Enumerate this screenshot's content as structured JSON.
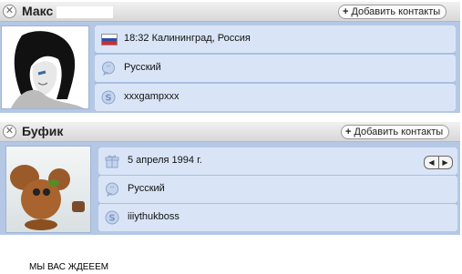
{
  "cards": [
    {
      "name": "Макс",
      "add_label": "Добавить контакты",
      "rows": [
        {
          "icon": "russia-flag-icon",
          "text": "18:32 Калининград, Россия"
        },
        {
          "icon": "speech-bubble-icon",
          "text": "Русский"
        },
        {
          "icon": "skype-icon",
          "text": "xxxgampxxx"
        }
      ]
    },
    {
      "name": "Буфик",
      "add_label": "Добавить контакты",
      "rows": [
        {
          "icon": "gift-icon",
          "text": "5 апреля 1994 г."
        },
        {
          "icon": "speech-bubble-icon",
          "text": "Русский"
        },
        {
          "icon": "skype-icon",
          "text": "iiiythukboss"
        }
      ]
    }
  ],
  "footer_text": "МЫ ВАС ЖДЕЕЕМ",
  "colors": {
    "panel_bg": "#b4c8e6",
    "row_bg": "#d9e5f6",
    "header_bg": "#e6e6e6",
    "flag_white": "#ffffff",
    "flag_blue": "#2c4ca8",
    "flag_red": "#d22c2c"
  }
}
